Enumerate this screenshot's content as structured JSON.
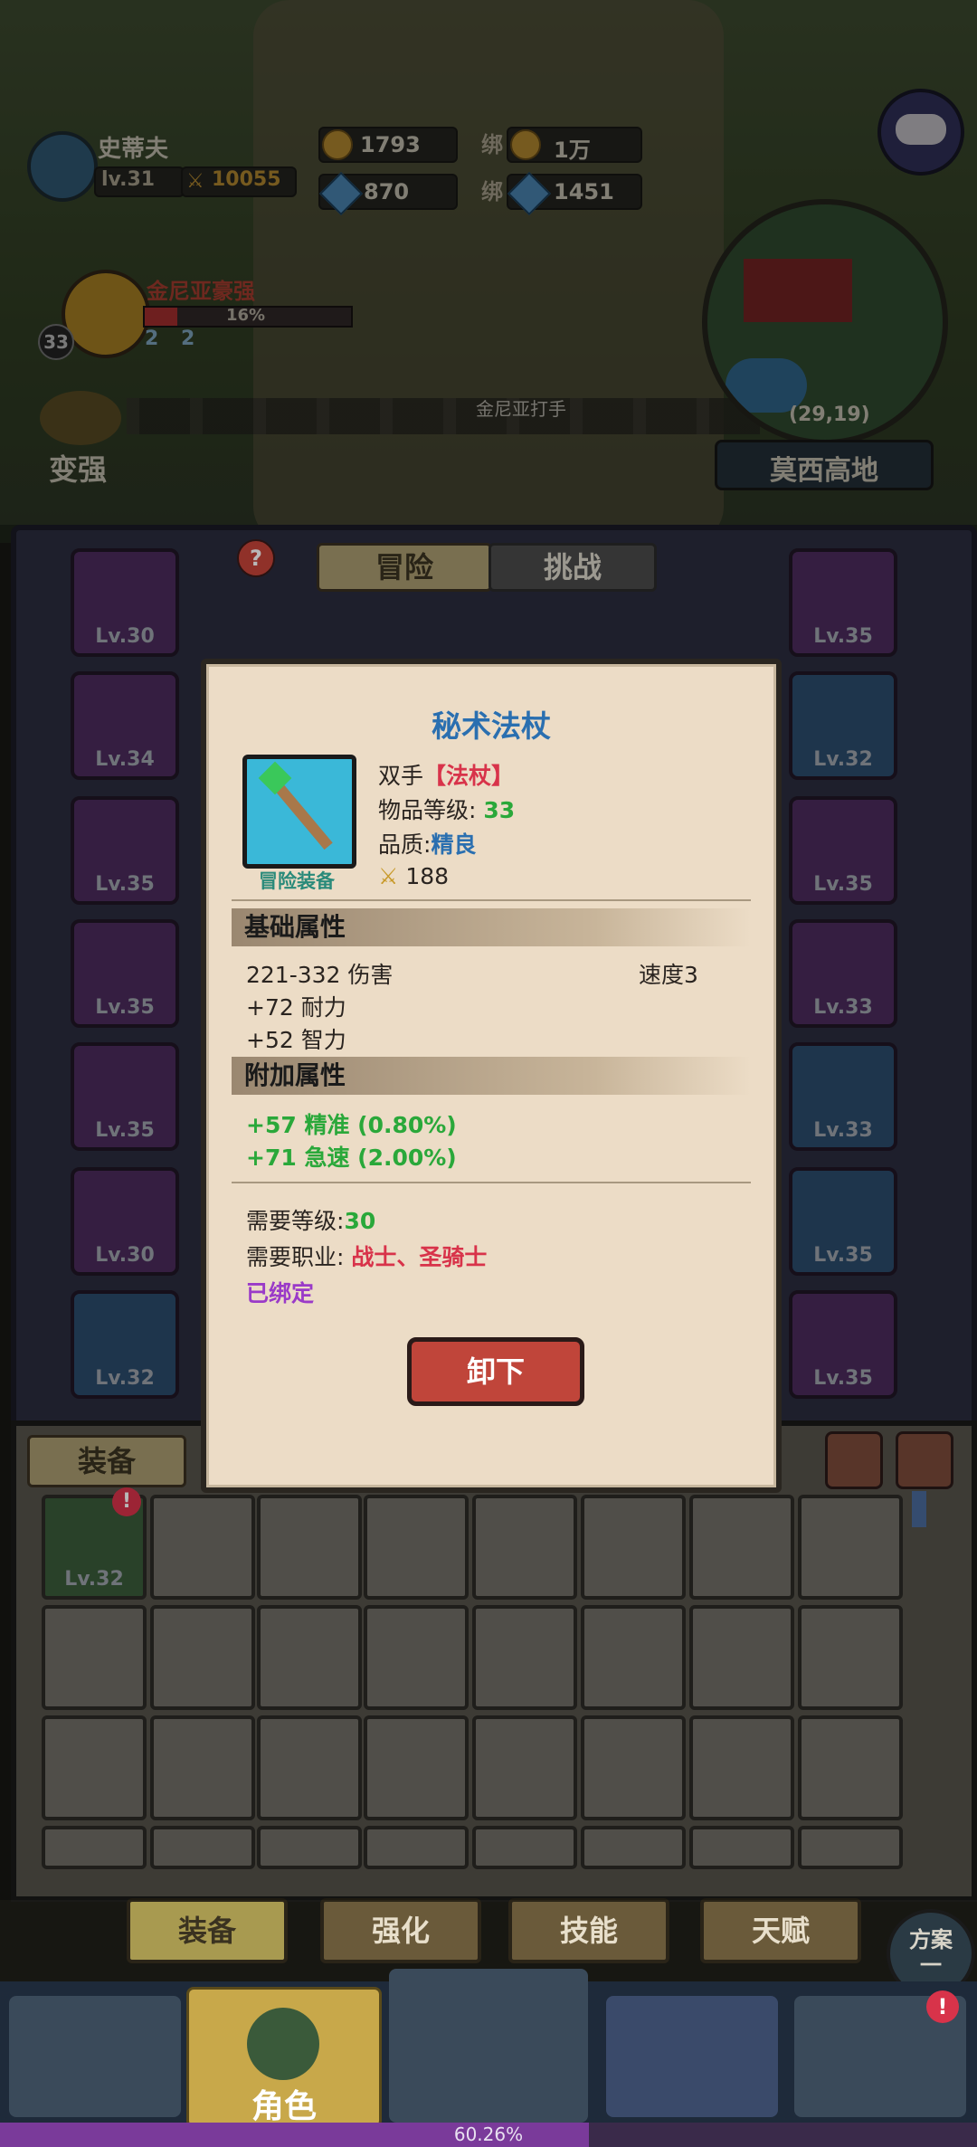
{
  "player": {
    "name": "史蒂夫",
    "level": "lv.31",
    "power": "10055"
  },
  "currency": {
    "gold": "1793",
    "bound_gold": "1万",
    "gems": "870",
    "bound_gems": "1451",
    "bound_label": "绑"
  },
  "quest": {
    "name": "金尼亚豪强",
    "percent": "16%",
    "badge_level": "33",
    "count_a": "2",
    "count_b": "2"
  },
  "strengthen_label": "变强",
  "npc_label": "金尼亚打手",
  "map": {
    "coords": "(29,19)",
    "zone": "莫西高地"
  },
  "panel": {
    "help": "?",
    "tabs": [
      "冒险",
      "挑战"
    ],
    "left_slots": [
      "Lv.30",
      "Lv.34",
      "Lv.35",
      "Lv.35",
      "Lv.35",
      "Lv.30",
      "Lv.32"
    ],
    "right_slots": [
      "Lv.35",
      "Lv.32",
      "Lv.35",
      "Lv.33",
      "Lv.33",
      "Lv.35",
      "Lv.35"
    ]
  },
  "inventory": {
    "label": "装备",
    "first_item_level": "Lv.32",
    "alert": "!"
  },
  "tooltip": {
    "name": "秘术法杖",
    "hand": "双手",
    "weapon_type": "【法杖】",
    "item_level_label": "物品等级:",
    "item_level": "33",
    "quality_label": "品质:",
    "quality": "精良",
    "power": "188",
    "category": "冒险装备",
    "base_header": "基础属性",
    "damage": "221-332 伤害",
    "speed": "速度3",
    "stat1": "+72 耐力",
    "stat2": "+52 智力",
    "extra_header": "附加属性",
    "extra1": "+57 精准 (0.80%)",
    "extra2": "+71 急速 (2.00%)",
    "req_level_label": "需要等级:",
    "req_level": "30",
    "req_class_label": "需要职业:",
    "req_class": "战士、圣骑士",
    "bound": "已绑定",
    "unequip": "卸下"
  },
  "sub_tabs": [
    "装备",
    "强化",
    "技能",
    "天赋"
  ],
  "plan_label": "方案一",
  "nav": {
    "role": "角色",
    "alert": "!"
  },
  "xp": {
    "text": "60.26%",
    "fraction": 0.6026
  },
  "colors": {
    "title_blue": "#2a6fb0",
    "green": "#2aa83a",
    "red": "#d8334a",
    "purple": "#9a3ac8"
  }
}
